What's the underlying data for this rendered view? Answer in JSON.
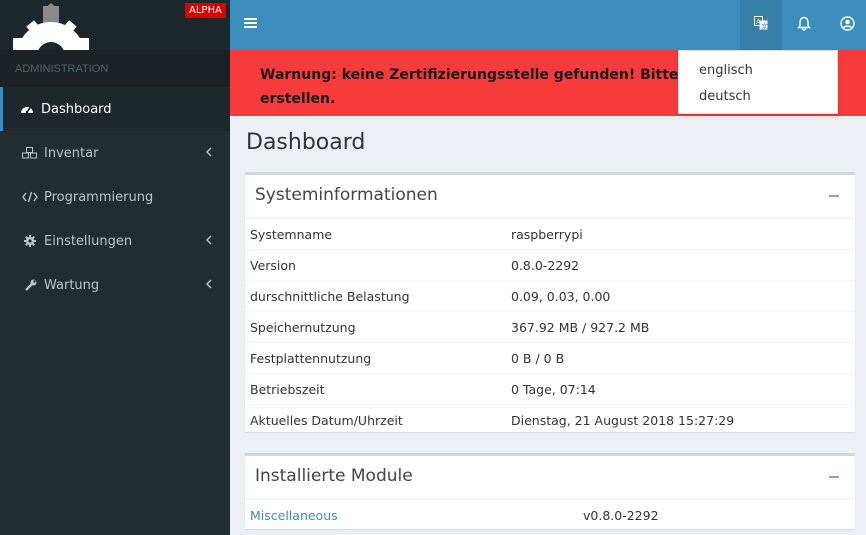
{
  "brand": {
    "badge": "ALPHA"
  },
  "sidebar": {
    "header": "ADMINISTRATION",
    "items": [
      {
        "label": "Dashboard",
        "icon": "dashboard-icon",
        "active": true
      },
      {
        "label": "Inventar",
        "icon": "cubes-icon",
        "has_children": true
      },
      {
        "label": "Programmierung",
        "icon": "code-icon"
      },
      {
        "label": "Einstellungen",
        "icon": "gear-icon",
        "has_children": true
      },
      {
        "label": "Wartung",
        "icon": "wrench-icon",
        "has_children": true
      }
    ]
  },
  "navbar": {
    "icons": [
      "language-icon",
      "bell-icon",
      "user-circle-icon"
    ]
  },
  "language_dropdown": {
    "options": [
      "englisch",
      "deutsch"
    ]
  },
  "warning": {
    "line1": "Warnung: keine Zertifizierungsstelle gefunden! Bitte klicken S",
    "line2": "erstellen."
  },
  "page": {
    "title": "Dashboard"
  },
  "system_info": {
    "title": "Systeminformationen",
    "rows": [
      {
        "key": "Systemname",
        "value": "raspberrypi"
      },
      {
        "key": "Version",
        "value": "0.8.0-2292"
      },
      {
        "key": "durschnittliche Belastung",
        "value": "0.09, 0.03, 0.00"
      },
      {
        "key": "Speichernutzung",
        "value": "367.92 MB / 927.2 MB"
      },
      {
        "key": "Festplattennutzung",
        "value": "0 B / 0 B"
      },
      {
        "key": "Betriebszeit",
        "value": "0 Tage, 07:14"
      },
      {
        "key": "Aktuelles Datum/Uhrzeit",
        "value": "Dienstag, 21 August 2018 15:27:29"
      }
    ]
  },
  "modules": {
    "title": "Installierte Module",
    "rows": [
      {
        "name": "Miscellaneous",
        "version": "v0.8.0-2292"
      }
    ]
  },
  "colors": {
    "navbar": "#3c8dbc",
    "sidebar": "#222d32",
    "warning": "#f53b3b",
    "alpha": "#dd0000"
  }
}
